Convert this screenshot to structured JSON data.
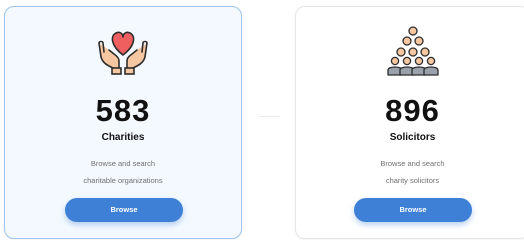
{
  "cards": [
    {
      "count": "583",
      "title": "Charities",
      "desc_line1": "Browse and search",
      "desc_line2": "charitable organizations",
      "button_label": "Browse",
      "icon": "hands-heart-icon"
    },
    {
      "count": "896",
      "title": "Solicitors",
      "desc_line1": "Browse and search",
      "desc_line2": "charity solicitors",
      "button_label": "Browse",
      "icon": "people-group-icon"
    }
  ],
  "colors": {
    "accent": "#3d80d6",
    "heart": "#f05f5f",
    "skin": "#f6c7a0",
    "group_shirt": "#9aa0ac",
    "selected_border": "#9ec4ee",
    "selected_bg": "#f4f9ff"
  }
}
